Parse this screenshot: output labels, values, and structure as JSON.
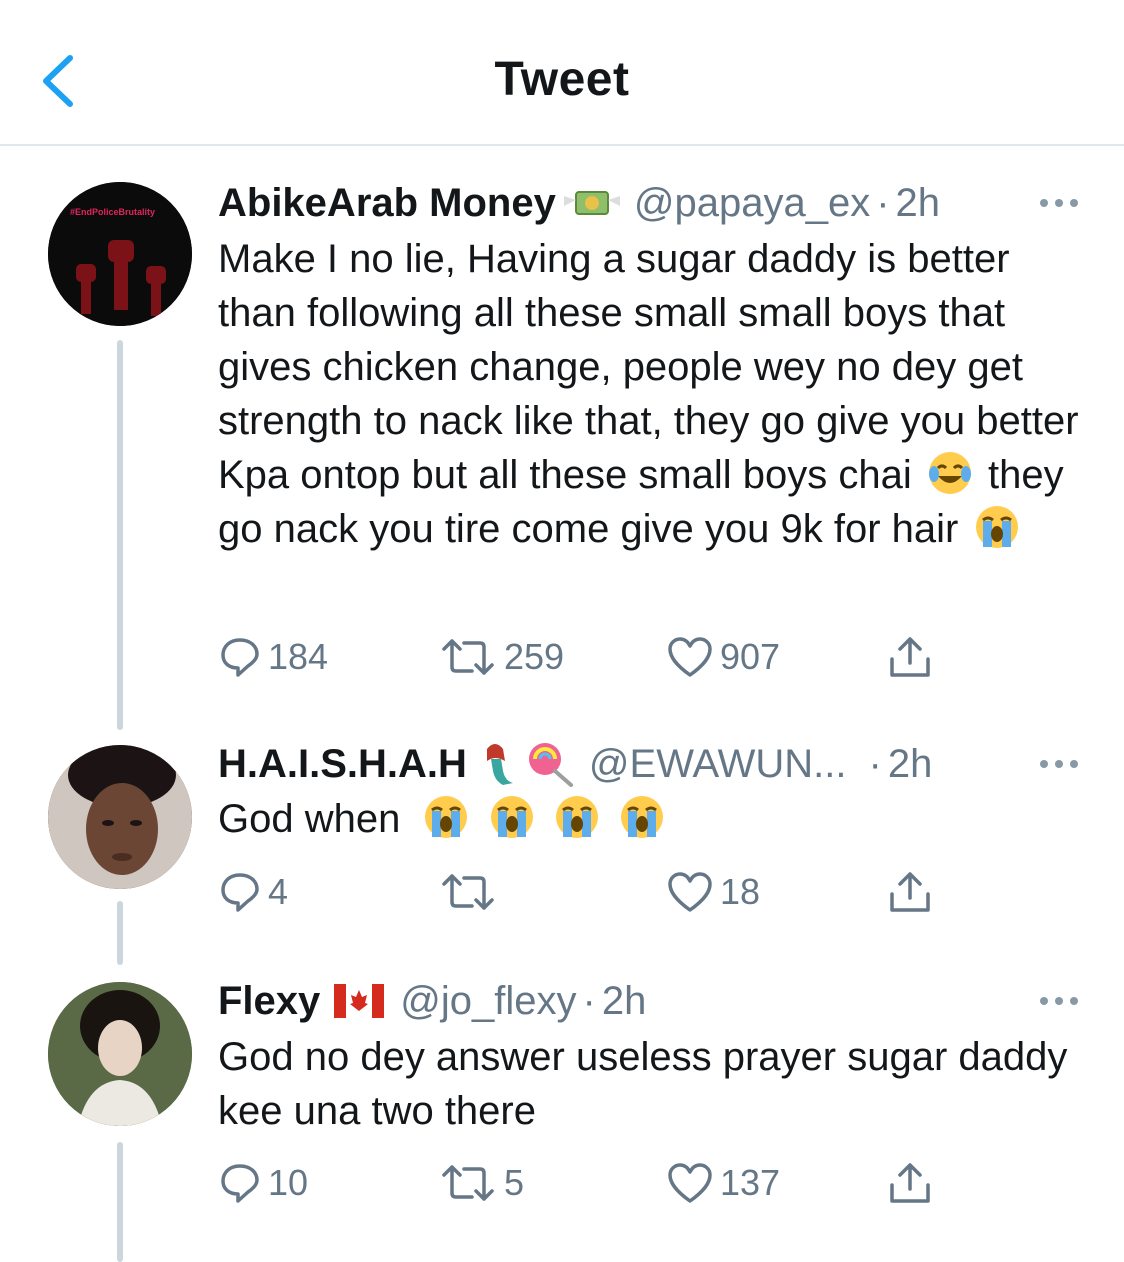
{
  "header": {
    "title": "Tweet"
  },
  "colors": {
    "accent": "#1da1f2",
    "secondary_text": "#657786",
    "divider": "#e1e8ed",
    "thread_line": "#ccd6dd"
  },
  "tweets": [
    {
      "name": "AbikeArab Money",
      "name_emoji": "money-with-wings-icon",
      "handle": "@papaya_ex",
      "separator": "·",
      "time": "2h",
      "avatar_text": "#EndPoliceBrutality",
      "text_parts": [
        "Make I no lie, Having a sugar daddy is better than following all these small small boys that gives chicken change, people wey no dey get strength to nack like that, they go give you better Kpa ontop but all these small boys chai",
        "they go nack you tire come give you 9k for hair"
      ],
      "text_emojis": [
        "tears-of-joy-icon",
        "loudly-crying-icon"
      ],
      "replies": "184",
      "retweets": "259",
      "likes": "907"
    },
    {
      "name": "H.A.I.S.H.A.H",
      "name_emoji": "mermaid-icon lollipop-icon",
      "handle": "@EWAWUN...",
      "separator": "·",
      "time": "2h",
      "text_parts": [
        "God when"
      ],
      "text_emojis": [
        "loudly-crying-icon",
        "loudly-crying-icon",
        "loudly-crying-icon",
        "loudly-crying-icon"
      ],
      "replies": "4",
      "retweets": "",
      "likes": "18"
    },
    {
      "name": "Flexy",
      "name_emoji": "canada-flag-icon",
      "handle": "@jo_flexy",
      "separator": "·",
      "time": "2h",
      "text_parts": [
        "God no dey answer useless prayer sugar daddy kee una two there"
      ],
      "text_emojis": [],
      "replies": "10",
      "retweets": "5",
      "likes": "137"
    }
  ]
}
